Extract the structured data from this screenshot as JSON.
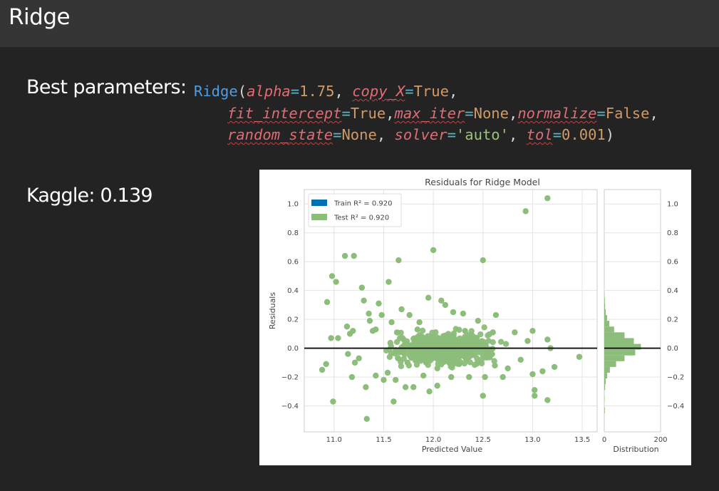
{
  "header": {
    "title": "Ridge"
  },
  "params": {
    "label": "Best parameters:",
    "class_name": "Ridge",
    "alpha_key": "alpha",
    "alpha_val": "1.75",
    "copy_key": "copy_X",
    "copy_val": "True",
    "fit_key": "fit_intercept",
    "fit_val": "True",
    "maxiter_key": "max_iter",
    "maxiter_val": "None",
    "norm_key": "normalize",
    "norm_val": "False",
    "rs_key": "random_state",
    "rs_val": "None",
    "solver_key": "solver",
    "solver_val": "'auto'",
    "tol_key": "tol",
    "tol_val": "0.001"
  },
  "kaggle": {
    "label": "Kaggle: 0.139"
  },
  "chart_data": {
    "type": "scatter",
    "title": "Residuals for Ridge Model",
    "xlabel": "Predicted Value",
    "ylabel": "Residuals",
    "xlim": [
      10.7,
      13.65
    ],
    "ylim": [
      -0.58,
      1.1
    ],
    "xticks": [
      11.0,
      11.5,
      12.0,
      12.5,
      13.0,
      13.5
    ],
    "yticks": [
      -0.4,
      -0.2,
      0.0,
      0.2,
      0.4,
      0.6,
      0.8,
      1.0
    ],
    "grid": true,
    "legend_position": "top-left",
    "series": [
      {
        "name": "Train R² = 0.920",
        "color": "#0072b2",
        "points": []
      },
      {
        "name": "Test R² = 0.920",
        "color": "#8cbd7a",
        "points": [
          [
            10.93,
            0.32
          ],
          [
            10.88,
            -0.15
          ],
          [
            10.92,
            -0.11
          ],
          [
            10.97,
            0.07
          ],
          [
            10.98,
            0.5
          ],
          [
            10.99,
            -0.37
          ],
          [
            11.02,
            0.46
          ],
          [
            11.04,
            0.07
          ],
          [
            11.11,
            0.64
          ],
          [
            11.2,
            0.64
          ],
          [
            11.13,
            0.15
          ],
          [
            11.16,
            0.1
          ],
          [
            11.19,
            0.12
          ],
          [
            11.14,
            -0.04
          ],
          [
            11.18,
            -0.2
          ],
          [
            11.21,
            -0.1
          ],
          [
            11.25,
            -0.07
          ],
          [
            11.28,
            0.42
          ],
          [
            11.32,
            -0.27
          ],
          [
            11.3,
            0.33
          ],
          [
            11.35,
            0.24
          ],
          [
            11.33,
            -0.49
          ],
          [
            11.36,
            0.19
          ],
          [
            11.39,
            0.12
          ],
          [
            11.42,
            -0.19
          ],
          [
            11.45,
            0.31
          ],
          [
            11.48,
            0.23
          ],
          [
            11.5,
            -0.22
          ],
          [
            11.55,
            0.46
          ],
          [
            11.58,
            0.18
          ],
          [
            11.6,
            -0.37
          ],
          [
            11.65,
            0.61
          ],
          [
            11.62,
            -0.22
          ],
          [
            11.68,
            0.27
          ],
          [
            11.72,
            -0.27
          ],
          [
            11.76,
            0.23
          ],
          [
            11.8,
            -0.27
          ],
          [
            11.84,
            0.13
          ],
          [
            11.9,
            -0.19
          ],
          [
            11.95,
            0.35
          ],
          [
            11.96,
            -0.3
          ],
          [
            12.0,
            0.68
          ],
          [
            12.04,
            -0.26
          ],
          [
            12.08,
            0.33
          ],
          [
            12.12,
            0.3
          ],
          [
            12.18,
            -0.2
          ],
          [
            12.2,
            0.25
          ],
          [
            12.3,
            0.24
          ],
          [
            12.36,
            -0.2
          ],
          [
            12.45,
            0.19
          ],
          [
            12.5,
            0.61
          ],
          [
            12.52,
            -0.2
          ],
          [
            12.5,
            -0.33
          ],
          [
            12.6,
            0.11
          ],
          [
            12.63,
            0.23
          ],
          [
            12.7,
            -0.2
          ],
          [
            12.75,
            -0.14
          ],
          [
            12.82,
            0.11
          ],
          [
            12.88,
            -0.08
          ],
          [
            12.93,
            0.95
          ],
          [
            12.95,
            0.05
          ],
          [
            13.0,
            0.12
          ],
          [
            13.0,
            -0.18
          ],
          [
            13.02,
            -0.29
          ],
          [
            13.02,
            -0.33
          ],
          [
            13.1,
            -0.16
          ],
          [
            13.15,
            0.06
          ],
          [
            13.15,
            1.04
          ],
          [
            13.15,
            -0.36
          ],
          [
            13.18,
            0.0
          ],
          [
            13.22,
            -0.13
          ],
          [
            13.47,
            -0.06
          ],
          [
            12.04,
            -0.14
          ],
          [
            11.54,
            -0.17
          ],
          [
            11.74,
            -0.1
          ],
          [
            12.26,
            -0.11
          ],
          [
            12.32,
            0.12
          ],
          [
            11.42,
            0.13
          ],
          [
            11.86,
            0.18
          ],
          [
            12.62,
            -0.12
          ]
        ]
      }
    ],
    "histogram": {
      "xlabel": "Distribution",
      "xlim": [
        0,
        200
      ],
      "xticks": [
        0,
        200
      ],
      "bin_centers": [
        -0.43,
        -0.39,
        -0.35,
        -0.31,
        -0.27,
        -0.23,
        -0.19,
        -0.15,
        -0.11,
        -0.07,
        -0.03,
        0.01,
        0.05,
        0.09,
        0.13,
        0.17,
        0.21,
        0.25,
        0.29,
        0.33,
        0.37
      ],
      "counts": [
        2,
        0,
        1,
        0,
        3,
        5,
        10,
        20,
        42,
        72,
        110,
        130,
        105,
        72,
        35,
        18,
        10,
        5,
        3,
        2,
        1
      ]
    },
    "zero_line": 0.0
  }
}
